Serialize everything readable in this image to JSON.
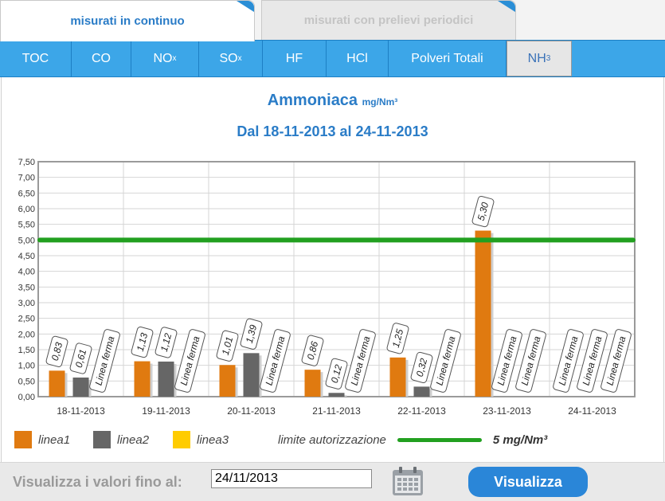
{
  "tabs": {
    "continuous": "misurati in continuo",
    "periodic": "misurati con prelievi periodici"
  },
  "subtabs": [
    {
      "label": "TOC",
      "sub": ""
    },
    {
      "label": "CO",
      "sub": ""
    },
    {
      "label": "NO",
      "sub": "x"
    },
    {
      "label": "SO",
      "sub": "x"
    },
    {
      "label": "HF",
      "sub": ""
    },
    {
      "label": "HCl",
      "sub": ""
    },
    {
      "label": "Polveri Totali",
      "sub": ""
    },
    {
      "label": "NH",
      "sub": "3"
    }
  ],
  "chart_header": {
    "title": "Ammoniaca",
    "unit": "mg/Nm³",
    "subtitle": "Dal 18-11-2013 al 24-11-2013"
  },
  "chart_data": {
    "type": "bar",
    "categories": [
      "18-11-2013",
      "19-11-2013",
      "20-11-2013",
      "21-11-2013",
      "22-11-2013",
      "23-11-2013",
      "24-11-2013"
    ],
    "ylim": [
      0,
      7.5
    ],
    "yticks": [
      "0,00",
      "0,50",
      "1,00",
      "1,50",
      "2,00",
      "2,50",
      "3,00",
      "3,50",
      "4,00",
      "4,50",
      "5,00",
      "5,50",
      "6,00",
      "6,50",
      "7,00",
      "7,50"
    ],
    "grid": true,
    "limit_value": 5.0,
    "series": [
      {
        "name": "linea1",
        "color": "#e07a10",
        "values": [
          0.83,
          1.13,
          1.01,
          0.86,
          1.25,
          5.3,
          null
        ],
        "labels": [
          "0,83",
          "1,13",
          "1,01",
          "0,86",
          "1,25",
          "5,30",
          "Linea ferma"
        ]
      },
      {
        "name": "linea2",
        "color": "#666666",
        "values": [
          0.61,
          1.12,
          1.39,
          0.12,
          0.32,
          null,
          null
        ],
        "labels": [
          "0,61",
          "1,12",
          "1,39",
          "0,12",
          "0,32",
          "Linea ferma",
          "Linea ferma"
        ]
      },
      {
        "name": "linea3",
        "color": "#ffcc00",
        "values": [
          null,
          null,
          null,
          null,
          null,
          null,
          null
        ],
        "labels": [
          "Linea ferma",
          "Linea ferma",
          "Linea ferma",
          "Linea ferma",
          "Linea ferma",
          "Linea ferma",
          "Linea ferma"
        ]
      }
    ]
  },
  "legend": {
    "linea1": "linea1",
    "linea2": "linea2",
    "linea3": "linea3",
    "limit_label": "limite autorizzazione",
    "limit_value": "5 mg/Nm³",
    "limit_color": "#22a020"
  },
  "footer": {
    "label": "Visualizza i valori fino al:",
    "date_value": "24/11/2013",
    "button": "Visualizza"
  }
}
